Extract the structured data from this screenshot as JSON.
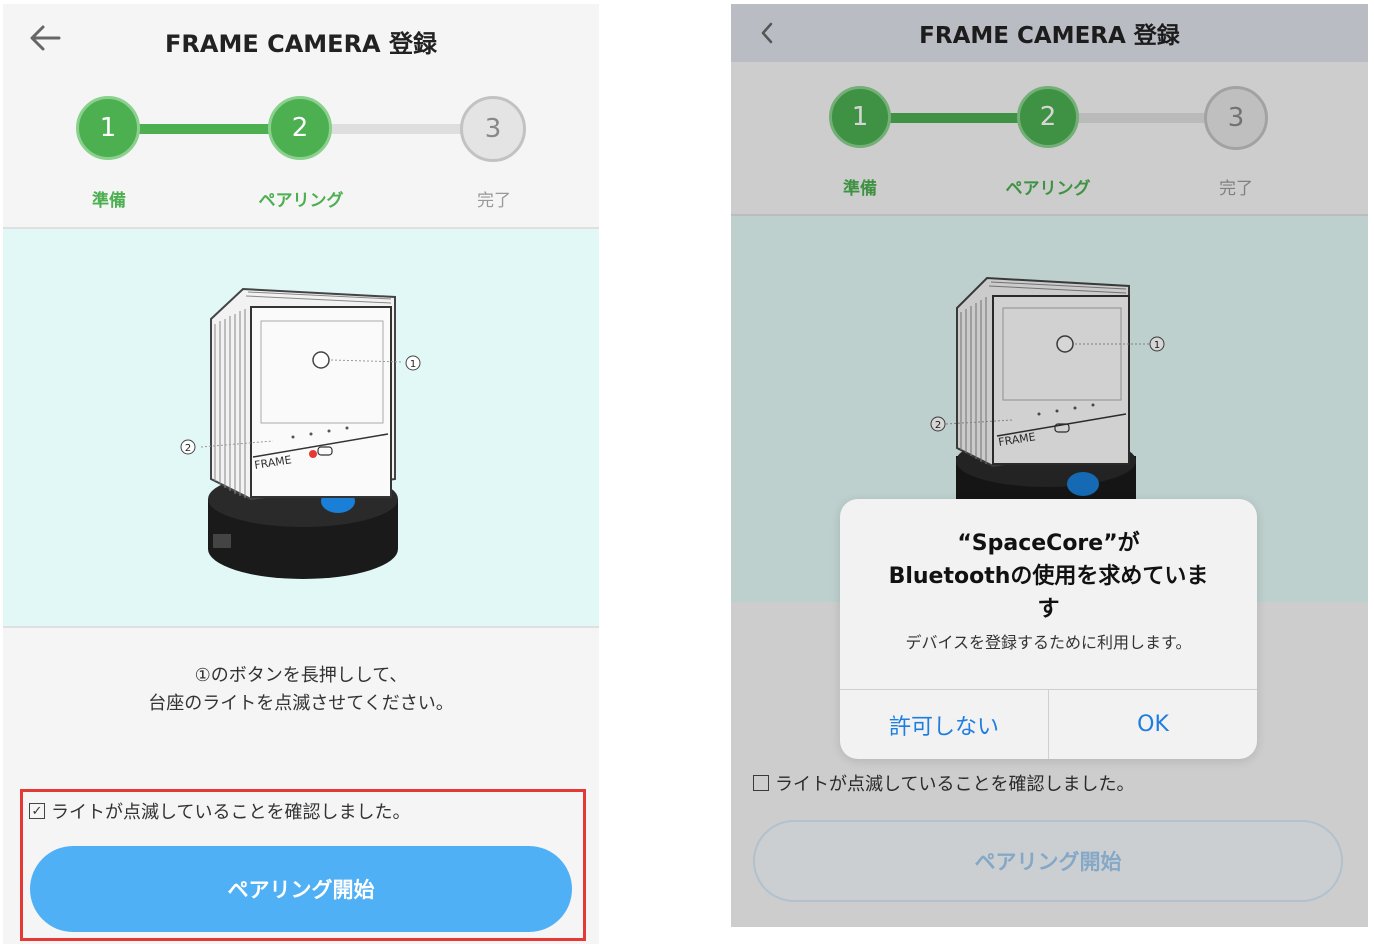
{
  "left_screen": {
    "title": "FRAME CAMERA 登録",
    "steps": [
      {
        "number": "1",
        "label": "準備",
        "state": "done"
      },
      {
        "number": "2",
        "label": "ペアリング",
        "state": "current"
      },
      {
        "number": "3",
        "label": "完了",
        "state": "todo"
      }
    ],
    "instruction_line1": "①のボタンを長押しして、",
    "instruction_line2": "台座のライトを点滅させてください。",
    "checkbox_label": "ライトが点滅していることを確認しました。",
    "checkbox_checked": true,
    "start_button": "ペアリング開始"
  },
  "right_screen": {
    "title": "FRAME CAMERA 登録",
    "steps": [
      {
        "number": "1",
        "label": "準備"
      },
      {
        "number": "2",
        "label": "ペアリング"
      },
      {
        "number": "3",
        "label": "完了"
      }
    ],
    "checkbox_label": "ライトが点滅していることを確認しました。",
    "checkbox_checked": false,
    "start_button": "ペアリング開始",
    "alert": {
      "title_line1": "“SpaceCore”が",
      "title_line2": "Bluetoothの使用を求めていま",
      "title_line3": "す",
      "message": "デバイスを登録するために利用します。",
      "deny_button": "許可しない",
      "ok_button": "OK"
    }
  },
  "device": {
    "callout_1": "1",
    "callout_2": "2",
    "brand": "FRAME"
  },
  "colors": {
    "accent_green": "#4caf50",
    "button_blue": "#4fb0f5",
    "illustration_bg": "#e2f8f6",
    "highlight_red": "#e53935",
    "ios_link_blue": "#1e7de0"
  }
}
